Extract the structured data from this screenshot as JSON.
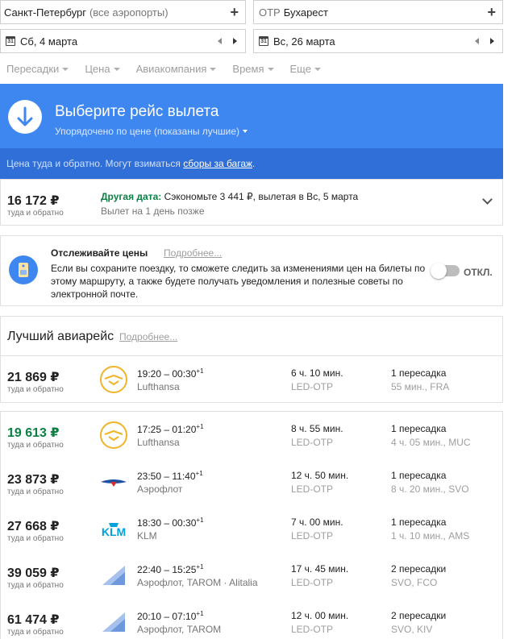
{
  "search": {
    "origin_value": "Санкт-Петербург",
    "origin_note": "(все аэропорты)",
    "dest_code": "OTP",
    "dest_value": "Бухарест",
    "plus": "+",
    "depart_date": "Сб, 4 марта",
    "return_date": "Вс, 26 марта",
    "cal_icon_label": "31"
  },
  "filters": [
    "Пересадки",
    "Цена",
    "Авиакомпания",
    "Время",
    "Еще"
  ],
  "banner": {
    "title": "Выберите рейс вылета",
    "subtitle": "Упорядочено по цене (показаны лучшие)",
    "note": "Цена туда и обратно. Могут взиматься ",
    "note_link": "сборы за багаж",
    "note_end": ".",
    "colors": {
      "primary": "#3f87f0",
      "dark": "#2f6fd7"
    }
  },
  "alt_date": {
    "price": "16 172 ₽",
    "price_note": "туда и обратно",
    "label_bold": "Другая дата:",
    "label_text": " Сэкономьте 3 441 ₽, вылетая в Вс, 5 марта",
    "sub": "Вылет на 1 день позже"
  },
  "tracking": {
    "title": "Отслеживайте цены",
    "more": "Подробнее...",
    "body": "Если вы сохраните поездку, то сможете следить за изменениями цен на билеты по этому маршруту, а также будете получать уведомления и полезные советы по электронной почте.",
    "toggle_label": "ОТКЛ.",
    "toggle_on": false
  },
  "best": {
    "title": "Лучший авиарейс",
    "more": "Подробнее...",
    "flight": {
      "price": "21 869 ₽",
      "price_note": "туда и обратно",
      "times": "19:20 – 00:30",
      "plus_day": "+1",
      "airline": "Lufthansa",
      "duration": "6 ч. 10 мин.",
      "route": "LED-OTP",
      "stops": "1 пересадка",
      "stop_detail": "55 мин., FRA",
      "logo": "lufthansa"
    }
  },
  "flights": [
    {
      "price": "19 613 ₽",
      "price_note": "туда и обратно",
      "green": true,
      "times": "17:25 – 01:20",
      "plus_day": "+1",
      "airline": "Lufthansa",
      "duration": "8 ч. 55 мин.",
      "route": "LED-OTP",
      "stops": "1 пересадка",
      "stop_detail": "4 ч. 05 мин., MUC",
      "logo": "lufthansa"
    },
    {
      "price": "23 873 ₽",
      "price_note": "туда и обратно",
      "green": false,
      "times": "23:50 – 11:40",
      "plus_day": "+1",
      "airline": "Аэрофлот",
      "duration": "12 ч. 50 мин.",
      "route": "LED-OTP",
      "stops": "1 пересадка",
      "stop_detail": "8 ч. 20 мин., SVO",
      "logo": "aeroflot"
    },
    {
      "price": "27 668 ₽",
      "price_note": "туда и обратно",
      "green": false,
      "times": "18:30 – 00:30",
      "plus_day": "+1",
      "airline": "KLM",
      "duration": "7 ч. 00 мин.",
      "route": "LED-OTP",
      "stops": "1 пересадка",
      "stop_detail": "1 ч. 10 мин., AMS",
      "logo": "klm"
    },
    {
      "price": "39 059 ₽",
      "price_note": "туда и обратно",
      "green": false,
      "times": "22:40 – 15:25",
      "plus_day": "+1",
      "airline": "Аэрофлот, TAROM · Alitalia",
      "duration": "17 ч. 45 мин.",
      "route": "LED-OTP",
      "stops": "2 пересадки",
      "stop_detail": "SVO, FCO",
      "logo": "multi"
    },
    {
      "price": "61 474 ₽",
      "price_note": "туда и обратно",
      "green": false,
      "times": "20:10 – 07:10",
      "plus_day": "+1",
      "airline": "Аэрофлот, TAROM",
      "duration": "12 ч. 00 мин.",
      "route": "LED-OTP",
      "stops": "2 пересадки",
      "stop_detail": "SVO, KIV",
      "logo": "multi"
    }
  ]
}
